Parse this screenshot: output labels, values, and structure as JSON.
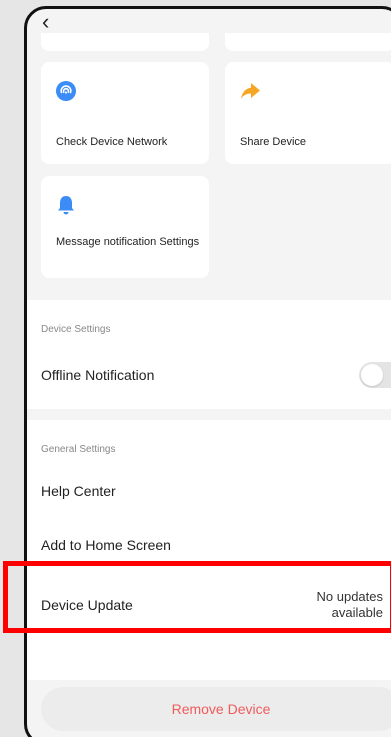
{
  "nav": {
    "back_icon": "chevron-left-icon"
  },
  "tiles": [
    {
      "label": "Check Device Network",
      "icon": "network-signal-icon",
      "color": "#3b8cf6"
    },
    {
      "label": "Share Device",
      "icon": "share-arrow-icon",
      "color": "#f5a623"
    },
    {
      "label": "Message notification Settings",
      "icon": "bell-icon",
      "color": "#3b8cf6"
    }
  ],
  "device_settings": {
    "title": "Device Settings",
    "offline_notification": {
      "label": "Offline Notification",
      "enabled": false
    }
  },
  "general_settings": {
    "title": "General Settings",
    "help_center": "Help Center",
    "add_home": "Add to Home Screen",
    "device_update": {
      "label": "Device Update",
      "value": "No updates available"
    }
  },
  "remove_device": "Remove Device",
  "colors": {
    "highlight": "#ff0000",
    "remove_text": "#ef5b5b"
  }
}
